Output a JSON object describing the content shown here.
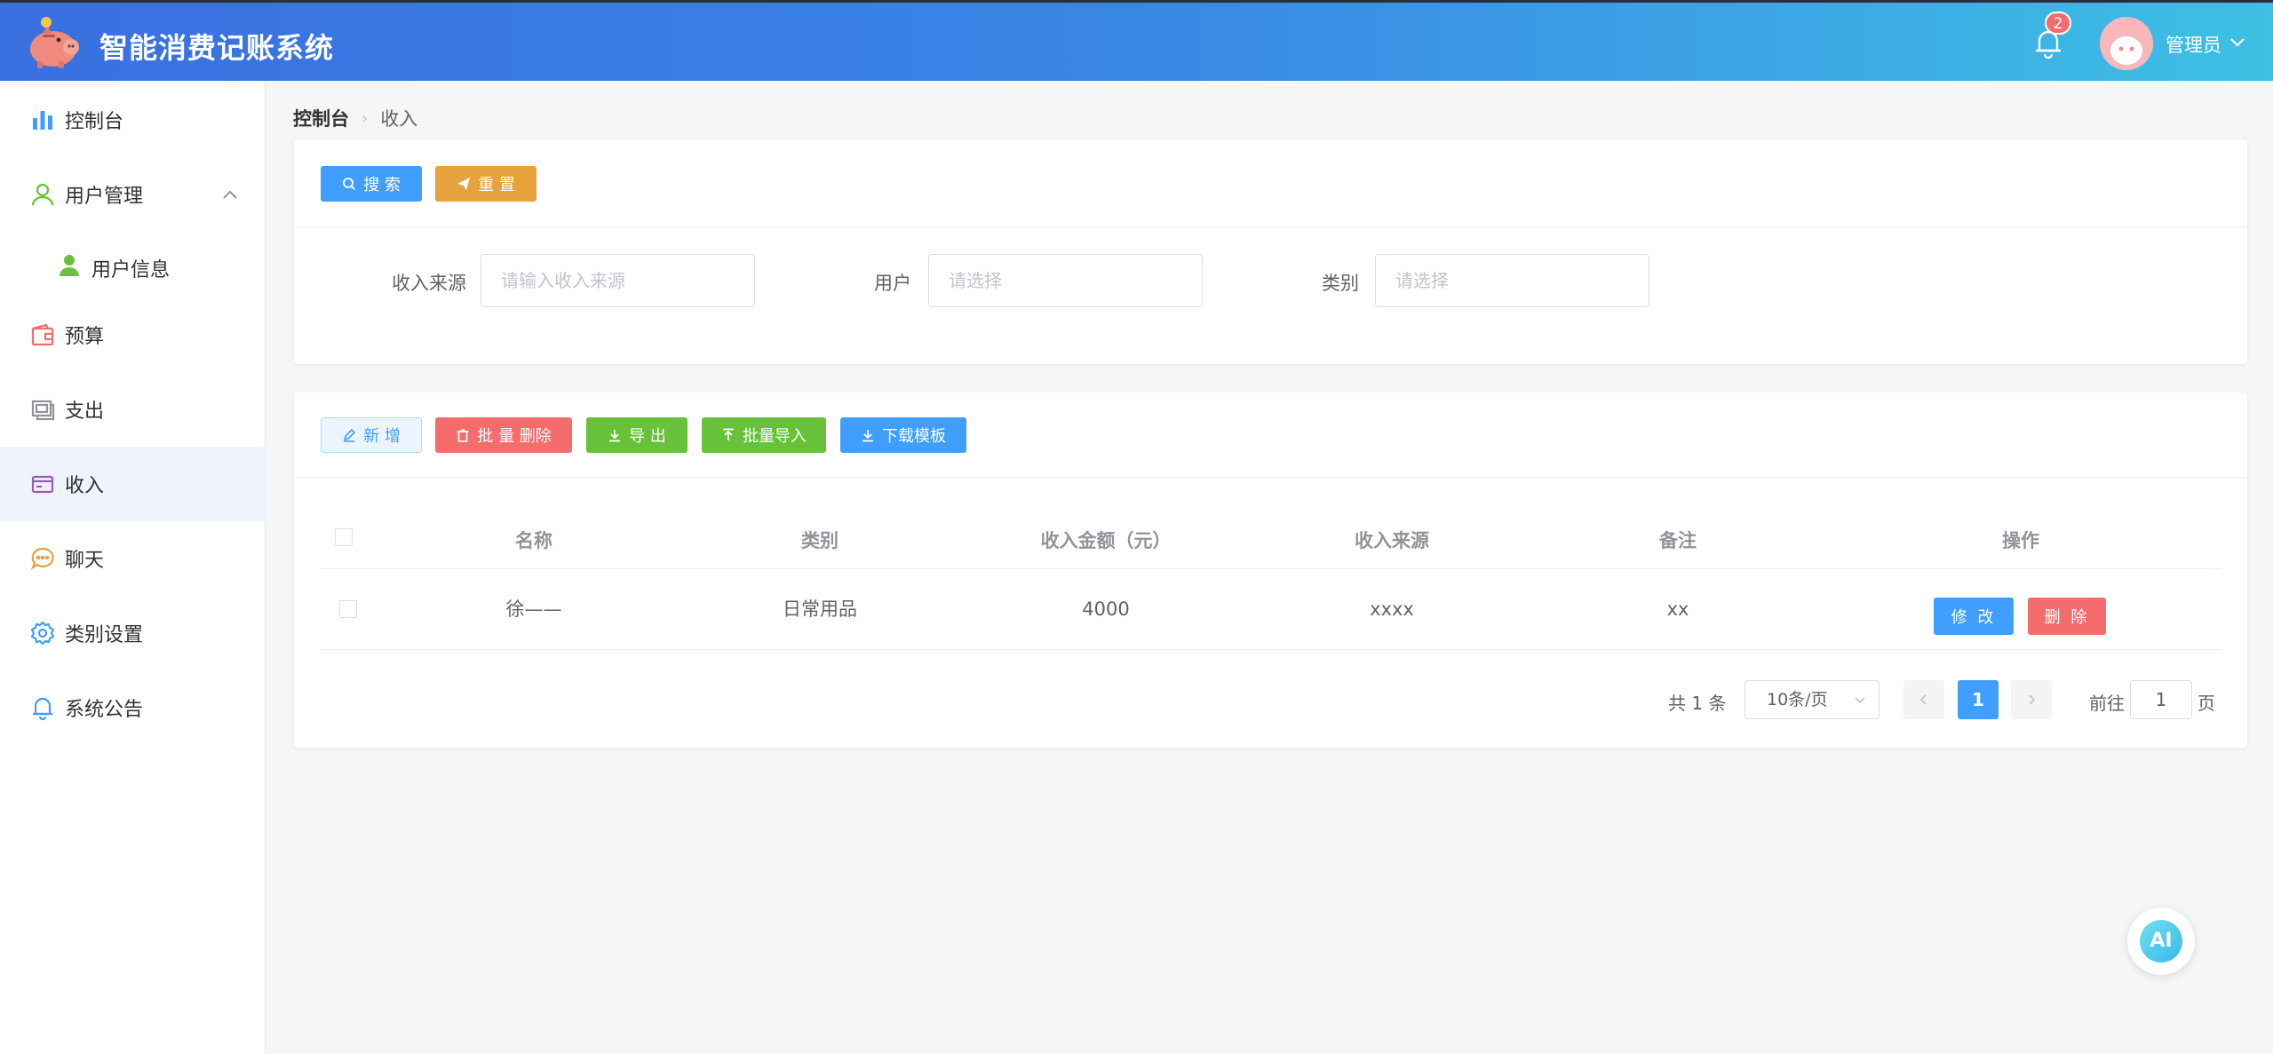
{
  "header": {
    "app_title": "智能消费记账系统",
    "notification_count": "2",
    "user_name": "管理员"
  },
  "sidebar": {
    "items": [
      {
        "label": "控制台",
        "icon": "bar-chart-icon"
      },
      {
        "label": "用户管理",
        "icon": "user-outline-icon",
        "expanded": true
      },
      {
        "label": "用户信息",
        "icon": "user-filled-icon"
      },
      {
        "label": "预算",
        "icon": "wallet-icon"
      },
      {
        "label": "支出",
        "icon": "picture-icon"
      },
      {
        "label": "收入",
        "icon": "credit-card-icon",
        "active": true
      },
      {
        "label": "聊天",
        "icon": "chat-dots-icon"
      },
      {
        "label": "类别设置",
        "icon": "gear-icon"
      },
      {
        "label": "系统公告",
        "icon": "bell-icon"
      }
    ]
  },
  "breadcrumb": {
    "home": "控制台",
    "current": "收入"
  },
  "search_panel": {
    "search_label": "搜 索",
    "reset_label": "重 置",
    "fields": {
      "source": {
        "label": "收入来源",
        "placeholder": "请输入收入来源"
      },
      "user": {
        "label": "用户",
        "placeholder": "请选择"
      },
      "category": {
        "label": "类别",
        "placeholder": "请选择"
      }
    }
  },
  "toolbar": {
    "add_label": "新 增",
    "batch_delete_label": "批 量 删除",
    "export_label": "导 出",
    "batch_import_label": "批量导入",
    "download_template_label": "下载模板"
  },
  "table": {
    "columns": [
      "名称",
      "类别",
      "收入金额（元）",
      "收入来源",
      "备注",
      "操作"
    ],
    "rows": [
      {
        "name": "徐——",
        "category": "日常用品",
        "amount": "4000",
        "source": "xxxx",
        "note": "xx",
        "edit_label": "修 改",
        "delete_label": "删 除"
      }
    ]
  },
  "pagination": {
    "total_text": "共 1 条",
    "page_size": "10条/页",
    "current_page": "1",
    "goto_label": "前往",
    "goto_value": "1",
    "page_suffix": "页"
  },
  "ai_button": {
    "label": "AI"
  },
  "colors": {
    "primary": "#409eff",
    "warning": "#e6a23c",
    "danger": "#f56c6c",
    "success": "#67c23a",
    "header_start": "#3a6fe0",
    "header_end": "#3dc0e4"
  }
}
